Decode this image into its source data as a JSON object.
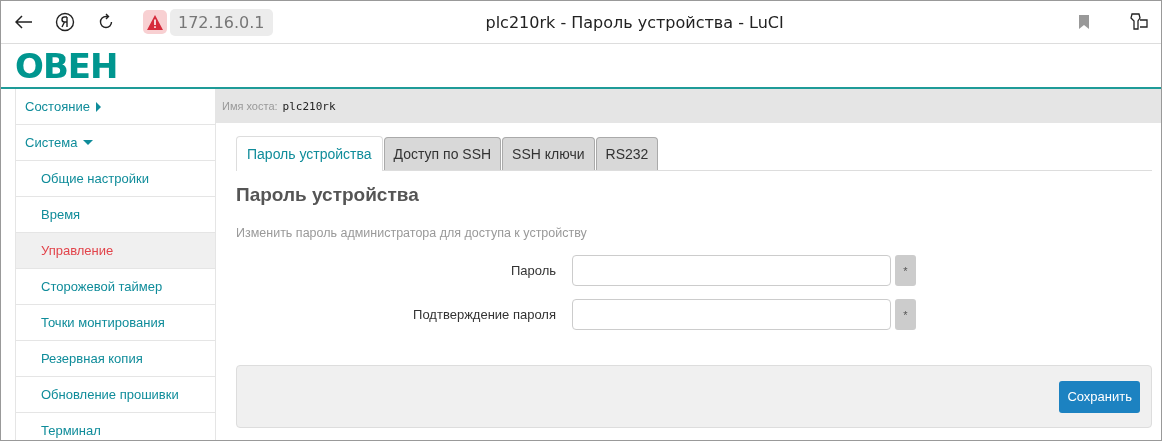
{
  "browser": {
    "address": "172.16.0.1",
    "title": "plc210rk - Пароль устройства - LuCI"
  },
  "logo_text": "ОВЕН",
  "sidebar": {
    "items": [
      {
        "label": "Состояние",
        "expanded": false,
        "selected": false
      },
      {
        "label": "Система",
        "expanded": true,
        "selected": false,
        "children": [
          {
            "label": "Общие настройки",
            "selected": false
          },
          {
            "label": "Время",
            "selected": false
          },
          {
            "label": "Управление",
            "selected": true
          },
          {
            "label": "Сторожевой таймер",
            "selected": false
          },
          {
            "label": "Точки монтирования",
            "selected": false
          },
          {
            "label": "Резервная копия",
            "selected": false
          },
          {
            "label": "Обновление прошивки",
            "selected": false
          },
          {
            "label": "Терминал",
            "selected": false
          }
        ]
      }
    ]
  },
  "hostname": {
    "label": "Имя хоста:",
    "value": "plc210rk"
  },
  "tabs": [
    {
      "label": "Пароль устройства",
      "selected": true
    },
    {
      "label": "Доступ по SSH",
      "selected": false
    },
    {
      "label": "SSH ключи",
      "selected": false
    },
    {
      "label": "RS232",
      "selected": false
    }
  ],
  "heading": "Пароль устройства",
  "description": "Изменить пароль администратора для доступа к устройству",
  "fields": [
    {
      "label": "Пароль",
      "marker": "*"
    },
    {
      "label": "Подтверждение пароля",
      "marker": "*"
    }
  ],
  "save_button": "Сохранить"
}
